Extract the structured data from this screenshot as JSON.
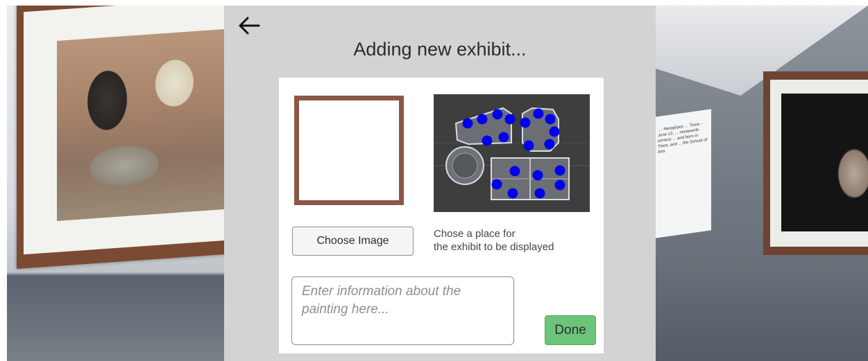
{
  "modal": {
    "title": "Adding new exhibit...",
    "back_icon": "arrow-left-icon",
    "choose_image_label": "Choose Image",
    "place_hint_line1": "Chose a place for",
    "place_hint_line2": "the exhibit to be displayed",
    "info_placeholder": "Enter information about the painting here...",
    "done_label": "Done"
  },
  "colors": {
    "panel_bg": "#d3d3d3",
    "frame_border": "#8b5746",
    "done_bg": "#6cc47b",
    "location_marker": "#0000ee"
  },
  "background_placard_text": "...: Νικηφόρος ... Tinos - June 13, ... nineteenth century ... and born in Tinos, and ... the School of Arts"
}
